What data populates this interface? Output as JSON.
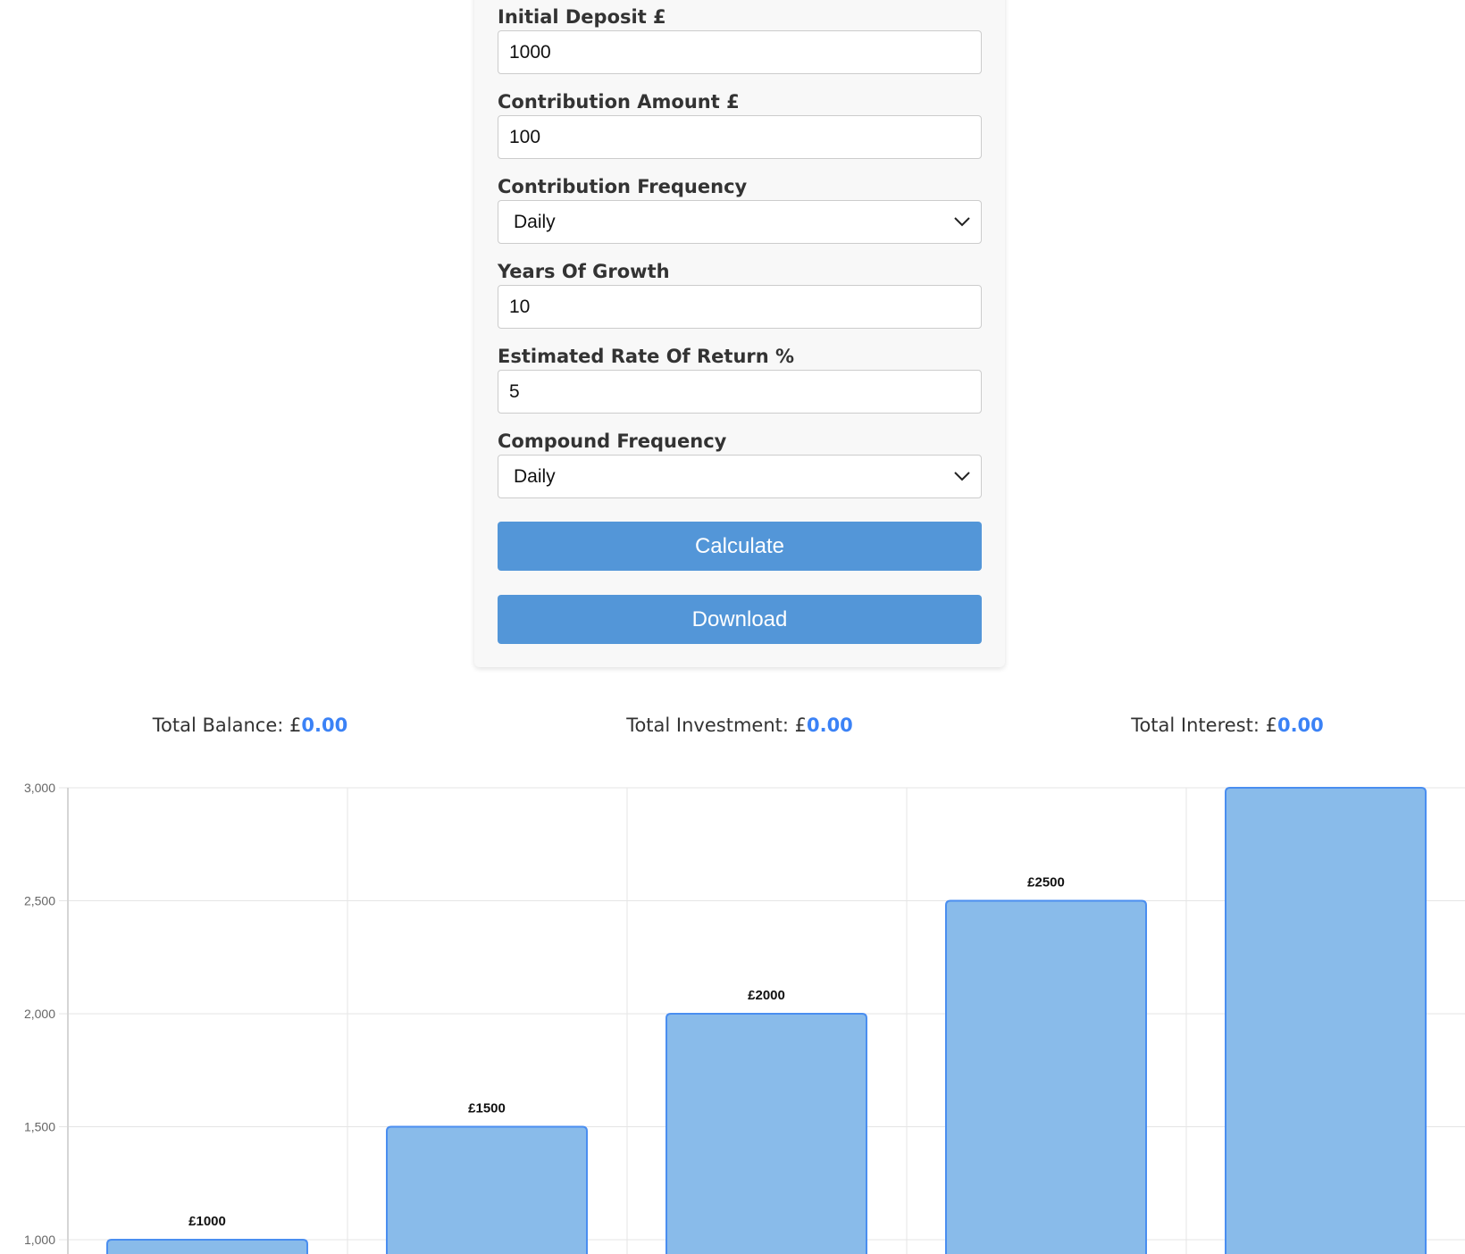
{
  "form": {
    "fields": [
      {
        "label": "Initial Deposit £",
        "value": "1000",
        "type": "input"
      },
      {
        "label": "Contribution Amount £",
        "value": "100",
        "type": "input"
      },
      {
        "label": "Contribution Frequency",
        "value": "Daily",
        "type": "select"
      },
      {
        "label": "Years Of Growth",
        "value": "10",
        "type": "input"
      },
      {
        "label": "Estimated Rate Of Return %",
        "value": "5",
        "type": "input"
      },
      {
        "label": "Compound Frequency",
        "value": "Daily",
        "type": "select"
      }
    ],
    "calculate_label": "Calculate",
    "download_label": "Download"
  },
  "totals": {
    "balance_label": "Total Balance: £",
    "balance_value": "0.00",
    "investment_label": "Total Investment: £",
    "investment_value": "0.00",
    "interest_label": "Total Interest: £",
    "interest_value": "0.00",
    "value_color": "#3b82f6"
  },
  "chart_data": {
    "type": "bar",
    "values": [
      1000,
      1500,
      2000,
      2500,
      3000
    ],
    "data_labels": [
      "£1000",
      "£1500",
      "£2000",
      "£2500",
      ""
    ],
    "yticks": [
      "1,000",
      "1,500",
      "2,000",
      "2,500",
      "3,000"
    ],
    "ylim": [
      0,
      3000
    ],
    "grid": true,
    "bar_color": "#89bbea",
    "bar_border_color": "#4a8ef0"
  }
}
